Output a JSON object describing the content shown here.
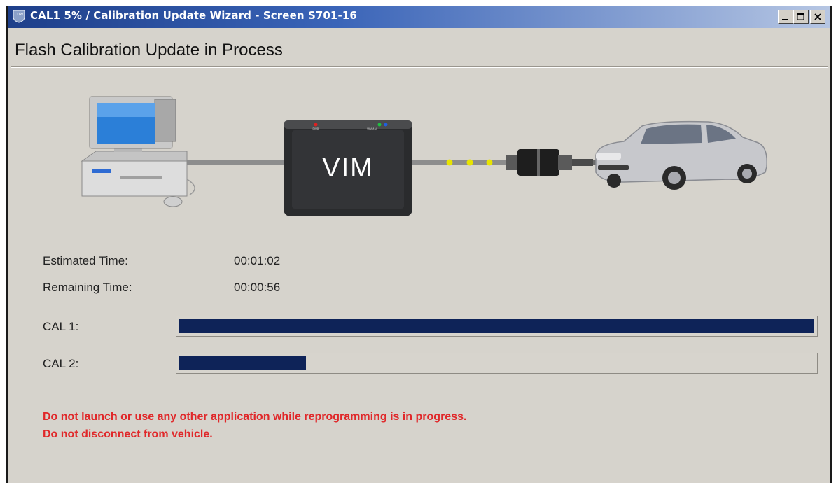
{
  "window": {
    "title": "CAL1 5% / Calibration Update Wizard - Screen S701-16",
    "app_icon_text": "CUW",
    "controls": [
      "minimize-icon",
      "maximize-icon",
      "close-icon"
    ]
  },
  "page": {
    "heading": "Flash Calibration Update in Process"
  },
  "illustration": {
    "vim_label": "VIM",
    "vim_led_left": "PWR",
    "vim_led_right": "WWAN"
  },
  "timing": {
    "estimated_label": "Estimated Time:",
    "estimated_value": "00:01:02",
    "remaining_label": "Remaining Time:",
    "remaining_value": "00:00:56"
  },
  "progress": [
    {
      "label": "CAL 1:",
      "fraction": 1.0
    },
    {
      "label": "CAL 2:",
      "fraction": 0.2
    }
  ],
  "warnings": [
    "Do not launch or use any other application while reprogramming is in progress.",
    "Do not disconnect from vehicle."
  ],
  "colors": {
    "progress_fill": "#0e2358",
    "warning_text": "#e0282a",
    "window_bg": "#d6d3cc",
    "titlebar": "#1e3f8a"
  }
}
